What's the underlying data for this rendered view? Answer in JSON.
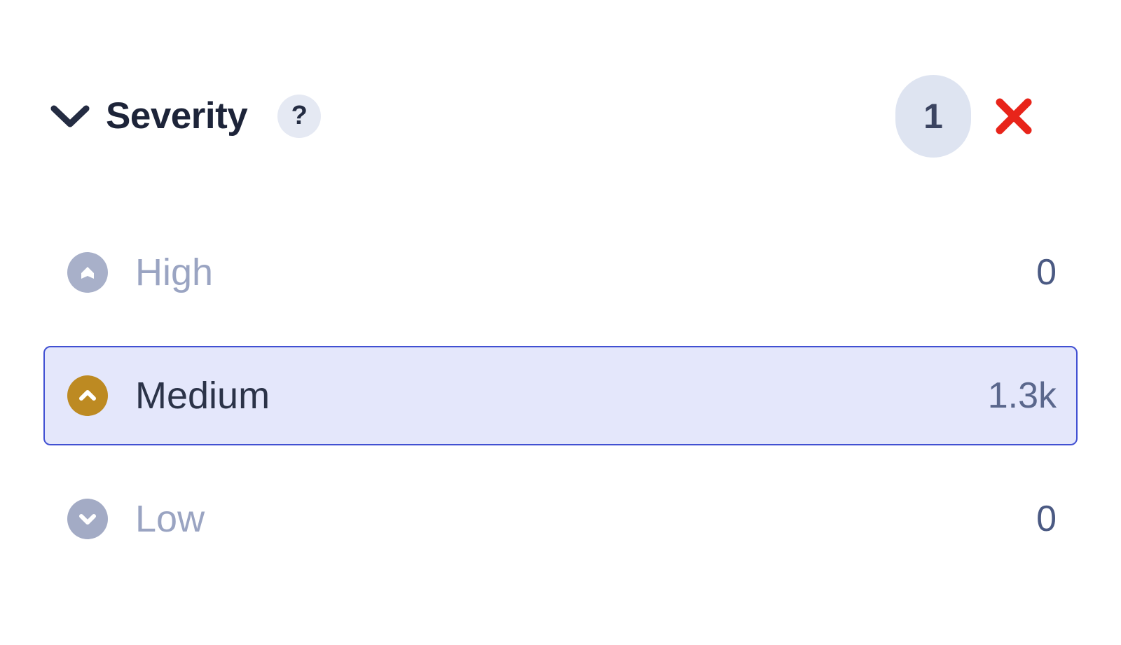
{
  "facet": {
    "title": "Severity",
    "collapse_icon": "chevron-down-icon",
    "help_icon": "question-mark-icon",
    "help_glyph": "?",
    "selected_count": "1",
    "clear_icon": "close-x-icon",
    "accent_selected_border": "#4150d2",
    "accent_selected_bg": "#e4e7fb",
    "clear_color": "#e8241a",
    "badge_bg": "#dee4f1"
  },
  "options": [
    {
      "label": "High",
      "count": "0",
      "icon": "severity-high-icon",
      "icon_color": "#a8b0c9",
      "selected": false
    },
    {
      "label": "Medium",
      "count": "1.3k",
      "icon": "severity-medium-icon",
      "icon_color": "#bd8a22",
      "selected": true
    },
    {
      "label": "Low",
      "count": "0",
      "icon": "severity-low-icon",
      "icon_color": "#a3abc5",
      "selected": false
    }
  ]
}
